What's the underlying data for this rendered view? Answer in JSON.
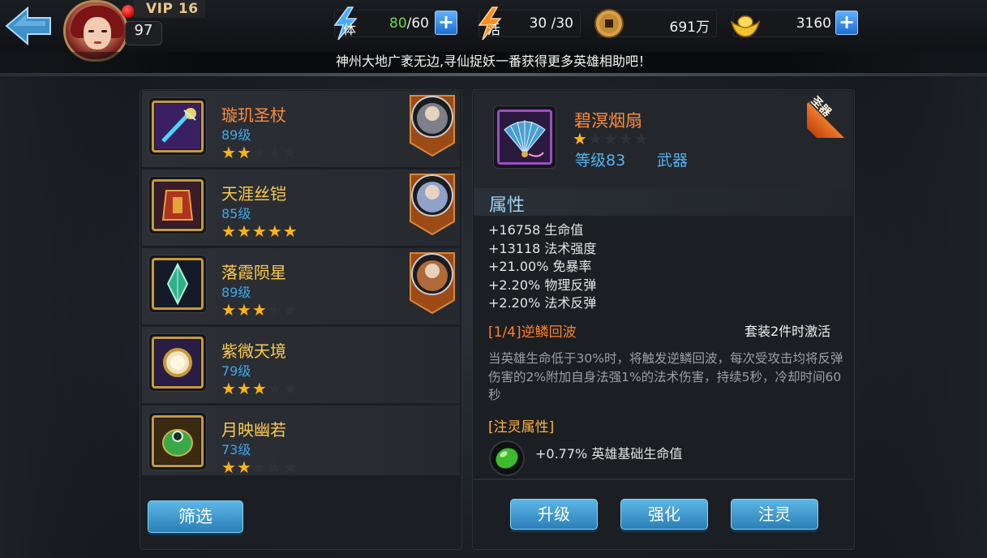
{
  "header": {
    "vip_label": "VIP 16",
    "player_level": "97",
    "stamina": {
      "icon": "stamina-lightning-icon",
      "label": "体",
      "current": "80",
      "max": "/60"
    },
    "vitality": {
      "icon": "vitality-lightning-icon",
      "label": "活",
      "value": "30 /30"
    },
    "coins": {
      "icon": "copper-coin-icon",
      "value": "691万"
    },
    "ingots": {
      "icon": "gold-ingot-icon",
      "value": "3160"
    },
    "plus_label": "+"
  },
  "banner_text": "神州大地广袤无边,寻仙捉妖一番获得更多英雄相助吧！",
  "equipment_list": [
    {
      "name": "璇玑圣杖",
      "level": "89级",
      "stars": 2,
      "name_color": "#ff8a3a",
      "frame_color": "#c79a3a",
      "has_hero": true,
      "icon": "staff-icon"
    },
    {
      "name": "天涯丝铠",
      "level": "85级",
      "stars": 5,
      "name_color": "#ffc94a",
      "frame_color": "#c79a3a",
      "has_hero": true,
      "icon": "armor-icon"
    },
    {
      "name": "落霞陨星",
      "level": "89级",
      "stars": 3,
      "name_color": "#ffc94a",
      "frame_color": "#c79a3a",
      "has_hero": true,
      "icon": "crystal-icon"
    },
    {
      "name": "紫微天境",
      "level": "79级",
      "stars": 3,
      "name_color": "#ffc94a",
      "frame_color": "#c79a3a",
      "has_hero": false,
      "icon": "mirror-icon"
    },
    {
      "name": "月映幽若",
      "level": "73级",
      "stars": 2,
      "name_color": "#ffc94a",
      "frame_color": "#c79a3a",
      "has_hero": false,
      "icon": "jade-pendant-icon"
    }
  ],
  "filter_label": "筛选",
  "detail": {
    "ribbon": "圣器",
    "name": "碧溟烟扇",
    "stars": 1,
    "level": "等级83",
    "type": "武器",
    "attr_title": "属性",
    "stats": [
      "+16758 生命值",
      "+13118 法术强度",
      "+21.00% 免暴率",
      "+2.20% 物理反弹",
      "+2.20% 法术反弹"
    ],
    "set_title": "[1/4]逆鳞回波",
    "set_condition": "套装2件时激活",
    "set_description": "当英雄生命低于30%时，将触发逆鳞回波，每次受攻击均将反弹伤害的2%附加自身法强1%的法术伤害，持续5秒，冷却时间60秒",
    "spirit_title": "[注灵属性]",
    "spirit_text": "+0.77% 英雄基础生命值"
  },
  "actions": {
    "upgrade": "升级",
    "enhance": "强化",
    "infuse": "注灵"
  },
  "colors": {
    "accent_blue": "#3ea8e8",
    "orange": "#ff8a3a",
    "star": "#ffb415"
  }
}
